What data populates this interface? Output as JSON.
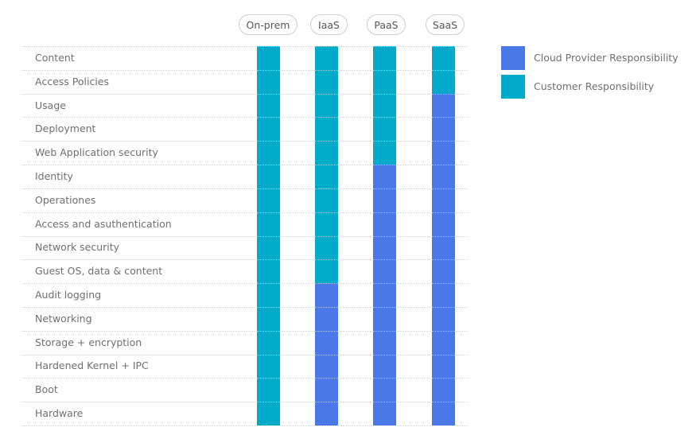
{
  "chart_data": {
    "type": "bar",
    "subtype": "stacked-responsibility-matrix",
    "title": "",
    "xlabel": "",
    "ylabel": "",
    "categories": [
      "On-prem",
      "IaaS",
      "PaaS",
      "SaaS"
    ],
    "rows": [
      "Content",
      "Access Policies",
      "Usage",
      "Deployment",
      "Web Application security",
      "Identity",
      "Operationes",
      "Access and asuthentication",
      "Network security",
      "Guest OS, data & content",
      "Audit logging",
      "Networking",
      "Storage + encryption",
      "Hardened Kernel + IPC",
      "Boot",
      "Hardware"
    ],
    "series": [
      {
        "name": "Cloud Provider Responsibility",
        "color": "#4a78e8",
        "values": [
          0,
          6,
          11,
          14
        ]
      },
      {
        "name": "Customer Responsibility",
        "color": "#00aac8",
        "values": [
          16,
          10,
          5,
          2
        ]
      }
    ],
    "stacking_note": "Customer responsibility covers the top rows; cloud provider covers the remaining bottom rows",
    "legend": {
      "placement": "top-right",
      "entries": [
        {
          "label": "Cloud Provider Responsibility",
          "color": "#4a78e8"
        },
        {
          "label": "Customer Responsibility",
          "color": "#00aac8"
        }
      ]
    },
    "grid": true
  }
}
